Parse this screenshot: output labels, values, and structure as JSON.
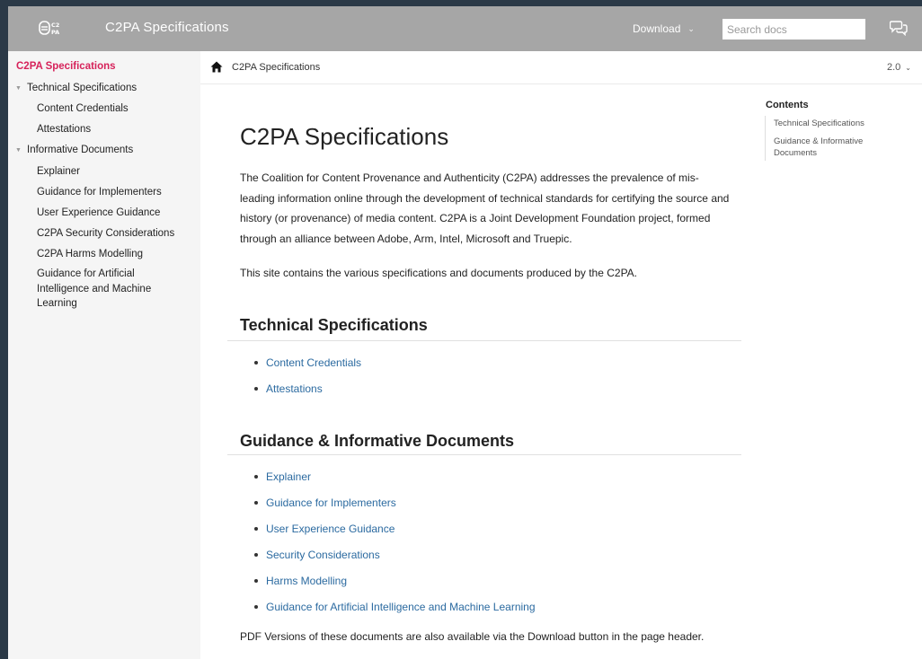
{
  "header": {
    "logo_text": "C2PA",
    "site_title": "C2PA Specifications",
    "download_label": "Download",
    "search_placeholder": "Search docs"
  },
  "sidebar": {
    "root": "C2PA Specifications",
    "groups": [
      {
        "label": "Technical Specifications",
        "items": [
          "Content Credentials",
          "Attestations"
        ]
      },
      {
        "label": "Informative Documents",
        "items": [
          "Explainer",
          "Guidance for Implementers",
          "User Experience Guidance",
          "C2PA Security Considerations",
          "C2PA Harms Modelling",
          "Guidance for Artificial Intelligence and Machine Learning"
        ]
      }
    ]
  },
  "breadcrumb": {
    "current": "C2PA Specifications",
    "version": "2.0"
  },
  "main": {
    "title": "C2PA Specifications",
    "intro": "The Coalition for Content Provenance and Authenticity (C2PA) addresses the prevalence of mis-leading information online through the development of technical standards for certifying the source and history (or provenance) of media content. C2PA is a Joint Development Foundation project, formed through an alliance between Adobe, Arm, Intel, Microsoft and Truepic.",
    "site_note": "This site contains the various specifications and documents produced by the C2PA.",
    "sections": [
      {
        "heading": "Technical Specifications",
        "links": [
          "Content Credentials",
          "Attestations"
        ]
      },
      {
        "heading": "Guidance & Informative Documents",
        "links": [
          "Explainer",
          "Guidance for Implementers",
          "User Experience Guidance",
          "Security Considerations",
          "Harms Modelling",
          "Guidance for Artificial Intelligence and Machine Learning"
        ]
      }
    ],
    "pdf_note": "PDF Versions of these documents are also available via the Download button in the page header."
  },
  "toc": {
    "title": "Contents",
    "items": [
      "Technical Specifications",
      "Guidance & Informative Documents"
    ]
  },
  "colors": {
    "header_bg": "#a6a6a6",
    "active_nav": "#d6225a",
    "link": "#2b6aa0",
    "page_bg": "#2b3947"
  }
}
